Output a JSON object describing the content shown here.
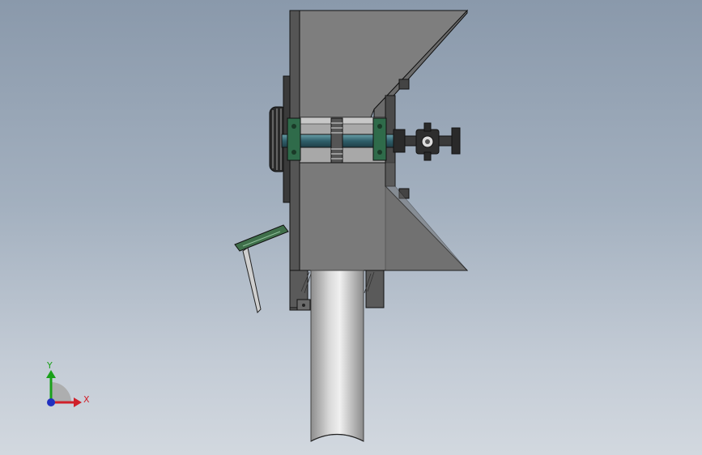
{
  "viewport": {
    "background_top": "#8a99ab",
    "background_bottom": "#d2d8df"
  },
  "model": {
    "frame_color": "#6e6e6e",
    "hopper_color": "#7a7a7a",
    "pipe_color": "#b8b8b8",
    "bearing_color": "#2f6b4a",
    "shaft_color": "#3b6f7a"
  },
  "triad": {
    "x_label": "X",
    "y_label": "Y",
    "x_color": "#d0202a",
    "y_color": "#1aa01a",
    "z_color": "#2030c0"
  }
}
